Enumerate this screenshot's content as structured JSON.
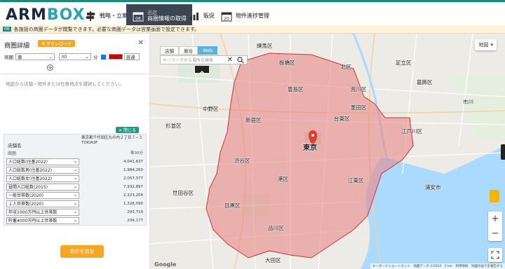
{
  "app": {
    "logo_part1": "ARM",
    "logo_part2": "BOX"
  },
  "nav": {
    "items": [
      {
        "label": "戦略・立案"
      },
      {
        "sub": "出店",
        "label": "商圏情報の取得"
      },
      {
        "label": "販促"
      },
      {
        "label": "物件進捗管理"
      }
    ],
    "calendar_day": "20"
  },
  "notice": {
    "tag": "06",
    "text": "各施設の商圏データが閲覧できます。必要な商圏データは営業画面で設定できます。"
  },
  "panel": {
    "title": "商圏詳細",
    "download_label": "ダウンロード",
    "close": "✕",
    "row_label": "商圏",
    "mode_value": "車",
    "minutes_value": "30",
    "minutes_unit": "分",
    "speed_value": "普通",
    "hint": "地図から店舗・物件または任意地点を選択してください。",
    "compare_label": "閉じる",
    "table": {
      "col_header": "店舗名",
      "sub_header": "商圏",
      "address": "東京都千代田区丸の内２丁目７−３ TOKIA3F",
      "unit": "車30分",
      "rows": [
        {
          "label": "人口総数(住基2022)",
          "value": "4,041,637"
        },
        {
          "label": "人口総数男(住基2022)",
          "value": "1,984,260"
        },
        {
          "label": "人口総数女(住基2022)",
          "value": "2,057,377"
        },
        {
          "label": "昼間人口総数(2015)",
          "value": "7,932,897"
        },
        {
          "label": "一般世帯数(2020)",
          "value": "2,323,204"
        },
        {
          "label": "１人世帯数(2020)",
          "value": "1,328,090"
        },
        {
          "label": "年収1000万円以上世帯数",
          "value": "293,719"
        },
        {
          "label": "貯蓄4000万円以上世帯数",
          "value": "234,177"
        }
      ]
    },
    "add_label": "条件を追加"
  },
  "map": {
    "tabs": [
      "店舗",
      "競合",
      "Web"
    ],
    "active_tab": "Web",
    "search_placeholder": "キーワードから場所を検索",
    "maptype_label": "地図",
    "attribution": "キーボードショートカット　地図データ ©2024　2 km　利用規約　地図の誤りを報告する",
    "google": "Google",
    "labels": [
      {
        "text": "練馬区"
      },
      {
        "text": "板橋区"
      },
      {
        "text": "北区"
      },
      {
        "text": "足立区"
      },
      {
        "text": "中野区"
      },
      {
        "text": "杉並区"
      },
      {
        "text": "新宿区"
      },
      {
        "text": "豊島区"
      },
      {
        "text": "荒川区"
      },
      {
        "text": "台東区"
      },
      {
        "text": "墨田区"
      },
      {
        "text": "葛飾区"
      },
      {
        "text": "江戸川区"
      },
      {
        "text": "渋谷区"
      },
      {
        "text": "港区"
      },
      {
        "text": "江東区"
      },
      {
        "text": "世田谷区"
      },
      {
        "text": "目黒区"
      },
      {
        "text": "品川区"
      },
      {
        "text": "大田区"
      },
      {
        "text": "市川"
      },
      {
        "text": "浦安市"
      },
      {
        "text": "東京"
      }
    ]
  },
  "colors": {
    "accent": "#1a8a7a",
    "orange": "#f5a623",
    "polygon_fill": "#e88080",
    "polygon_stroke": "#cc3333"
  }
}
